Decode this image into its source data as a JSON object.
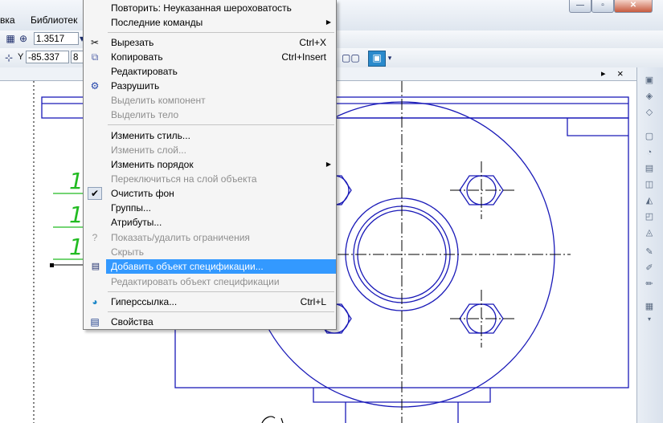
{
  "menubar": {
    "items": [
      "вка",
      "Библиотек"
    ]
  },
  "window_buttons": [
    "minimize-icon",
    "maximize-icon",
    "close-icon"
  ],
  "toolbar1": {
    "zoom_value": "1.3517",
    "zoom_arrow": "▾"
  },
  "toolbar2": {
    "y_label": "Y",
    "y_value": "-85.337",
    "x_partial": "8"
  },
  "docbar": {
    "nav_arrow": "▸",
    "close": "×"
  },
  "drawing": {
    "dim_digits": [
      "1",
      "1",
      "1"
    ]
  },
  "context_menu": {
    "items": [
      {
        "label": "Повторить: Неуказанная шероховатость",
        "shortcut": "",
        "disabled": false,
        "icon": ""
      },
      {
        "label": "Последние команды",
        "shortcut": "",
        "disabled": false,
        "icon": "",
        "submenu": true
      },
      {
        "label": "Вырезать",
        "shortcut": "Ctrl+X",
        "disabled": false,
        "icon": "scissors-icon"
      },
      {
        "label": "Копировать",
        "shortcut": "Ctrl+Insert",
        "disabled": false,
        "icon": "copy-icon"
      },
      {
        "label": "Редактировать",
        "shortcut": "",
        "disabled": false,
        "icon": ""
      },
      {
        "label": "Разрушить",
        "shortcut": "",
        "disabled": false,
        "icon": "destroy-icon"
      },
      {
        "label": "Выделить компонент",
        "shortcut": "",
        "disabled": true,
        "icon": ""
      },
      {
        "label": "Выделить тело",
        "shortcut": "",
        "disabled": true,
        "icon": ""
      },
      {
        "label": "Изменить стиль...",
        "shortcut": "",
        "disabled": false,
        "icon": ""
      },
      {
        "label": "Изменить слой...",
        "shortcut": "",
        "disabled": true,
        "icon": ""
      },
      {
        "label": "Изменить порядок",
        "shortcut": "",
        "disabled": false,
        "icon": "",
        "submenu": true
      },
      {
        "label": "Переключиться на слой объекта",
        "shortcut": "",
        "disabled": true,
        "icon": ""
      },
      {
        "label": "Очистить фон",
        "shortcut": "",
        "disabled": false,
        "icon": "checkmark-icon"
      },
      {
        "label": "Группы...",
        "shortcut": "",
        "disabled": false,
        "icon": ""
      },
      {
        "label": "Атрибуты...",
        "shortcut": "",
        "disabled": false,
        "icon": ""
      },
      {
        "label": "Показать/удалить ограничения",
        "shortcut": "",
        "disabled": true,
        "icon": "constraints-icon"
      },
      {
        "label": "Скрыть",
        "shortcut": "",
        "disabled": true,
        "icon": ""
      },
      {
        "label": "Добавить объект спецификации...",
        "shortcut": "",
        "disabled": false,
        "icon": "spec-object-icon",
        "highlighted": true
      },
      {
        "label": "Редактировать объект спецификации",
        "shortcut": "",
        "disabled": true,
        "icon": ""
      },
      {
        "label": "Гиперссылка...",
        "shortcut": "Ctrl+L",
        "disabled": false,
        "icon": "hyperlink-icon"
      },
      {
        "label": "Свойства",
        "shortcut": "",
        "disabled": false,
        "icon": "properties-icon"
      }
    ]
  },
  "colors": {
    "drawing_line": "#1a1ab8",
    "dimension": "#22bb22",
    "highlight": "#3399ff"
  }
}
